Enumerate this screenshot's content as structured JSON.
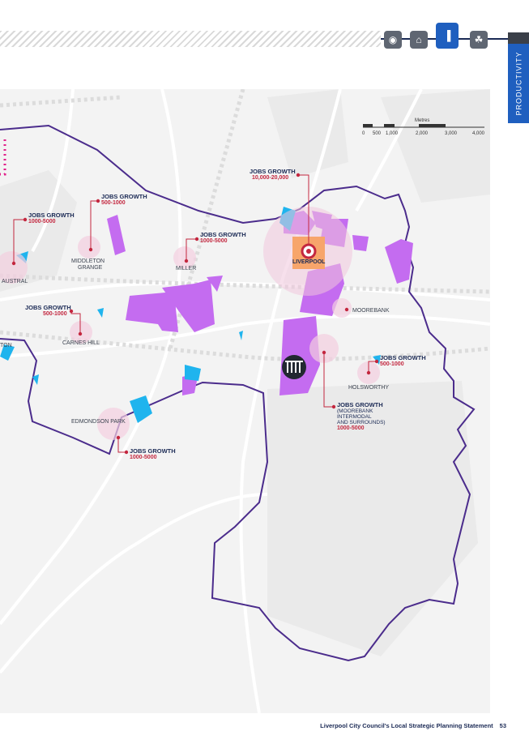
{
  "header": {
    "nav_icons": [
      {
        "name": "people-icon",
        "glyph": "◉"
      },
      {
        "name": "house-icon",
        "glyph": "⌂"
      },
      {
        "name": "chart-icon",
        "glyph": "▐"
      },
      {
        "name": "tree-icon",
        "glyph": "☘"
      }
    ],
    "side_tab": "PRODUCTIVITY"
  },
  "scale": {
    "label": "Metres",
    "ticks": [
      "0",
      "500",
      "1,000",
      "2,000",
      "3,000",
      "4,000"
    ]
  },
  "places": {
    "austral": "AUSTRAL",
    "middleton": [
      "MIDDLETON",
      "GRANGE"
    ],
    "miller": "MILLER",
    "liverpool": "LIVERPOOL",
    "moorebank": "MOOREBANK",
    "carnes_hill": "CARNES HILL",
    "edmondson_park": "EDMONDSON PARK",
    "holsworthy": "HOLSWORTHY",
    "leppington_partial": "TON"
  },
  "jobs": {
    "title": "JOBS GROWTH",
    "austral": "1000-5000",
    "middleton": "500-1000",
    "miller": "1000-5000",
    "liverpool": "10,000-20,000",
    "carnes_hill": "500-1000",
    "holsworthy": "500-1000",
    "edmondson": "1000-5000",
    "moorebank_sub": [
      "(MOOREBANK",
      "INTERMODAL",
      "AND SURROUNDS)"
    ],
    "moorebank": "1000-5000"
  },
  "footer": {
    "title": "Liverpool City Council's Local Strategic Planning Statement",
    "page": "53"
  },
  "colors": {
    "boundary": "#4b2c8c",
    "employment": "#c46cf0",
    "water": "#1fb4ee",
    "accent": "#c3273f",
    "liverpool_centre": "#f7a56b"
  }
}
